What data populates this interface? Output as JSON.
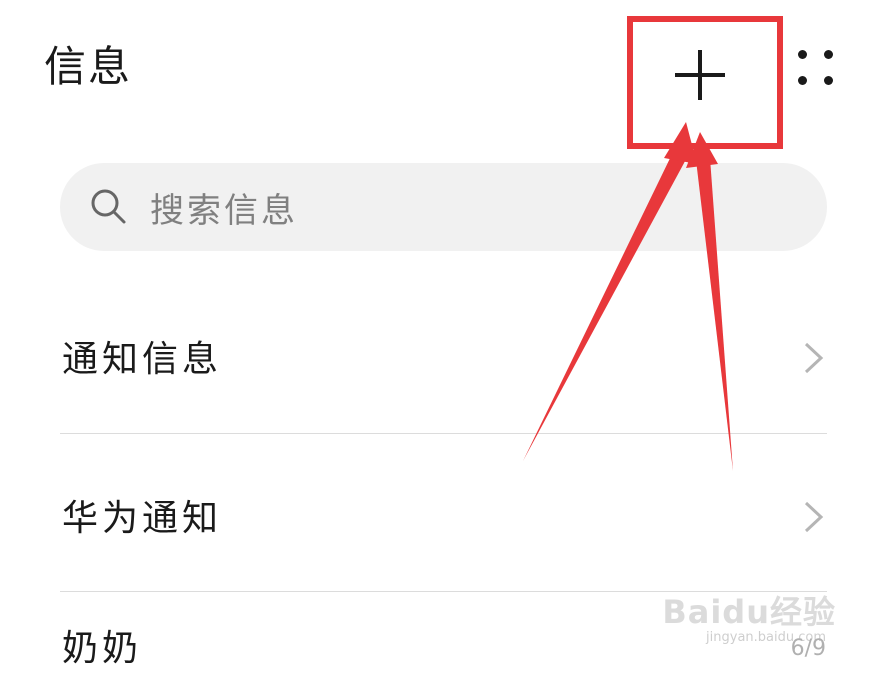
{
  "header": {
    "title": "信息",
    "add_icon": "plus-icon",
    "more_icon": "more-dots-icon"
  },
  "search": {
    "placeholder": "搜索信息",
    "icon": "search-icon"
  },
  "list": {
    "items": [
      {
        "label": "通知信息",
        "icon": "chevron-right-icon"
      },
      {
        "label": "华为通知",
        "icon": "chevron-right-icon"
      },
      {
        "label": "奶奶"
      }
    ]
  },
  "annotation": {
    "color": "#e8383b"
  },
  "watermark": {
    "brand": "Baidu经验",
    "url": "jingyan.baidu.com",
    "page": "6/9"
  }
}
